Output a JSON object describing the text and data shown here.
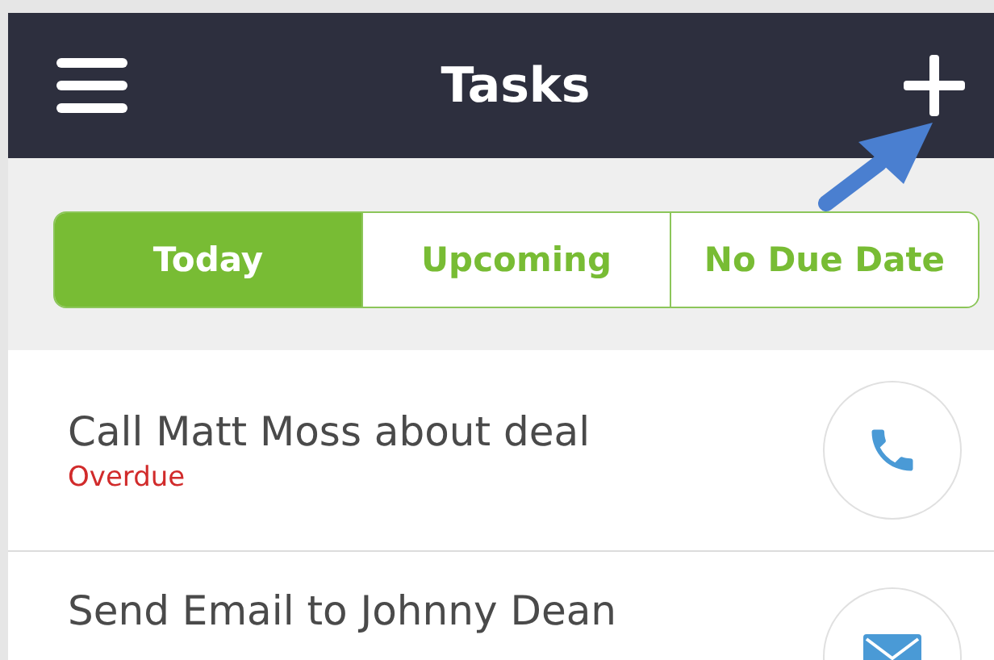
{
  "header": {
    "title": "Tasks"
  },
  "tabs": [
    {
      "label": "Today",
      "selected": true
    },
    {
      "label": "Upcoming",
      "selected": false
    },
    {
      "label": "No Due Date",
      "selected": false
    }
  ],
  "tasks": [
    {
      "title": "Call Matt Moss about deal",
      "status": "Overdue",
      "kind": "phone"
    },
    {
      "title": "Send Email to Johnny Dean",
      "kind": "email"
    }
  ]
}
